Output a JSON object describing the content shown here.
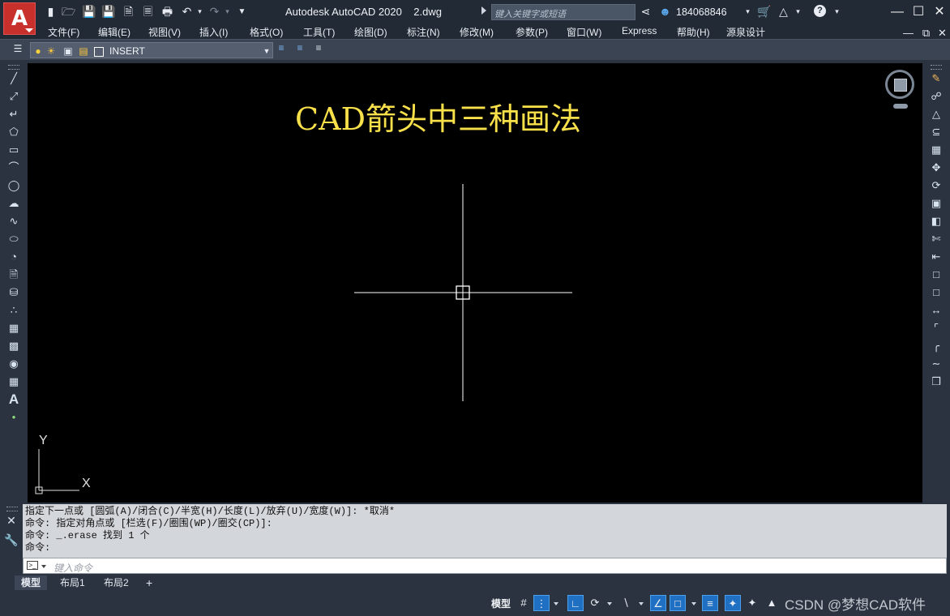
{
  "window": {
    "app_letter": "A",
    "title": "Autodesk AutoCAD 2020    2.dwg",
    "search_placeholder": "键入关键字或短语",
    "user": "184068846"
  },
  "menu": [
    "文件(F)",
    "编辑(E)",
    "视图(V)",
    "插入(I)",
    "格式(O)",
    "工具(T)",
    "绘图(D)",
    "标注(N)",
    "修改(M)",
    "参数(P)",
    "窗口(W)",
    "Express",
    "帮助(H)",
    "源泉设计"
  ],
  "layer": {
    "current": "INSERT"
  },
  "drawing": {
    "title": "CAD箭头中三种画法",
    "ucs_x": "X",
    "ucs_y": "Y"
  },
  "command": {
    "history": [
      "指定下一点或 [圆弧(A)/闭合(C)/半宽(H)/长度(L)/放弃(U)/宽度(W)]: *取消*",
      "命令: 指定对角点或 [栏选(F)/圈围(WP)/圈交(CP)]:",
      "命令: _.erase 找到 1 个",
      "命令:"
    ],
    "placeholder": "键入命令"
  },
  "tabs": [
    "模型",
    "布局1",
    "布局2"
  ],
  "tab_add": "+",
  "status": {
    "model": "模型",
    "watermark": "CSDN @梦想CAD软件"
  },
  "colors": {
    "accent_blue": "#1f6fc2",
    "drawing_title": "#f8e04a",
    "canvas_bg": "#000000",
    "app_logo": "#c8302c"
  },
  "icons": {
    "left_toolbar": [
      "line-icon",
      "xline-icon",
      "polyline-icon",
      "polygon-icon",
      "rectangle-icon",
      "arc-icon",
      "circle-icon",
      "revcloud-icon",
      "spline-icon",
      "ellipse-icon",
      "ellipse-arc-icon",
      "insert-block-icon",
      "make-block-icon",
      "point-icon",
      "hatch-icon",
      "gradient-icon",
      "region-icon",
      "table-icon",
      "mtext-icon",
      "add-selected-icon"
    ],
    "right_toolbar": [
      "erase-icon",
      "copy-icon",
      "mirror-icon",
      "offset-icon",
      "array-icon",
      "move-icon",
      "rotate-icon",
      "scale-icon",
      "stretch-icon",
      "trim-icon",
      "extend-icon",
      "break-at-point-icon",
      "break-icon",
      "join-icon",
      "chamfer-icon",
      "fillet-icon",
      "blend-icon",
      "explode-icon"
    ]
  }
}
